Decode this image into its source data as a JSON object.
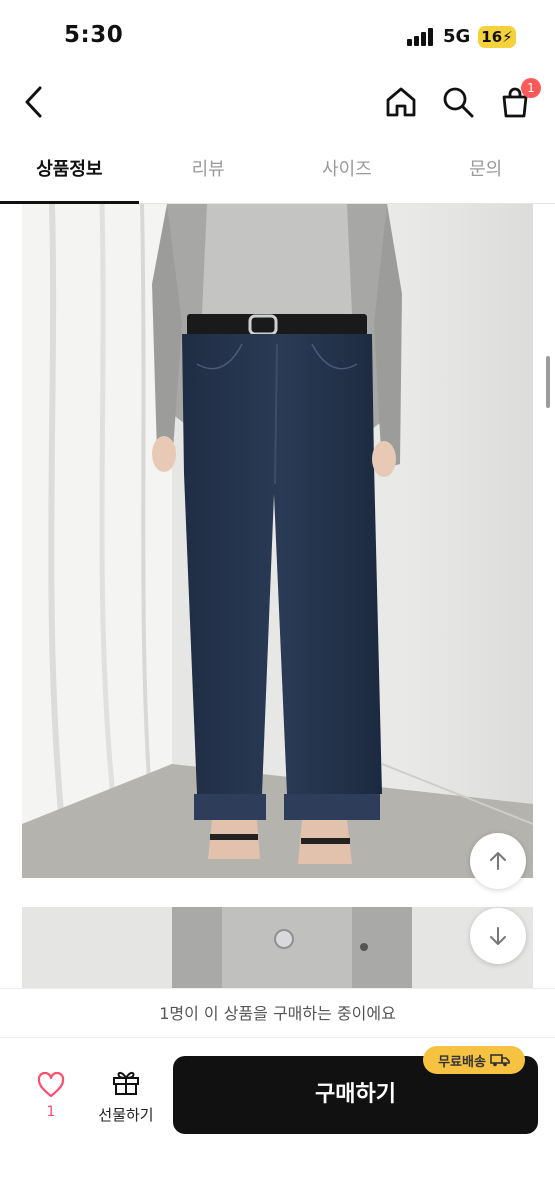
{
  "status_bar": {
    "time": "5:30",
    "network": "5G",
    "battery": "16"
  },
  "header": {
    "back_icon": "chevron-left-icon",
    "home_icon": "home-icon",
    "search_icon": "search-icon",
    "cart_icon": "shopping-bag-icon",
    "cart_count": "1"
  },
  "tabs": [
    {
      "label": "상품정보",
      "active": true
    },
    {
      "label": "리뷰",
      "active": false
    },
    {
      "label": "사이즈",
      "active": false
    },
    {
      "label": "문의",
      "active": false
    }
  ],
  "product_images": [
    "dark-wash-wide-leg-jeans-front",
    "grey-knit-cardigan-detail"
  ],
  "notice_text": "1명이 이 상품을 구매하는 중이에요",
  "actions": {
    "like_count": "1",
    "gift_label": "선물하기",
    "buy_label": "구매하기",
    "free_shipping_label": "무료배송"
  },
  "colors": {
    "accent": "#111111",
    "like": "#ff4d6d",
    "badge": "#f5c242",
    "cart_badge": "#ff5a5a"
  }
}
